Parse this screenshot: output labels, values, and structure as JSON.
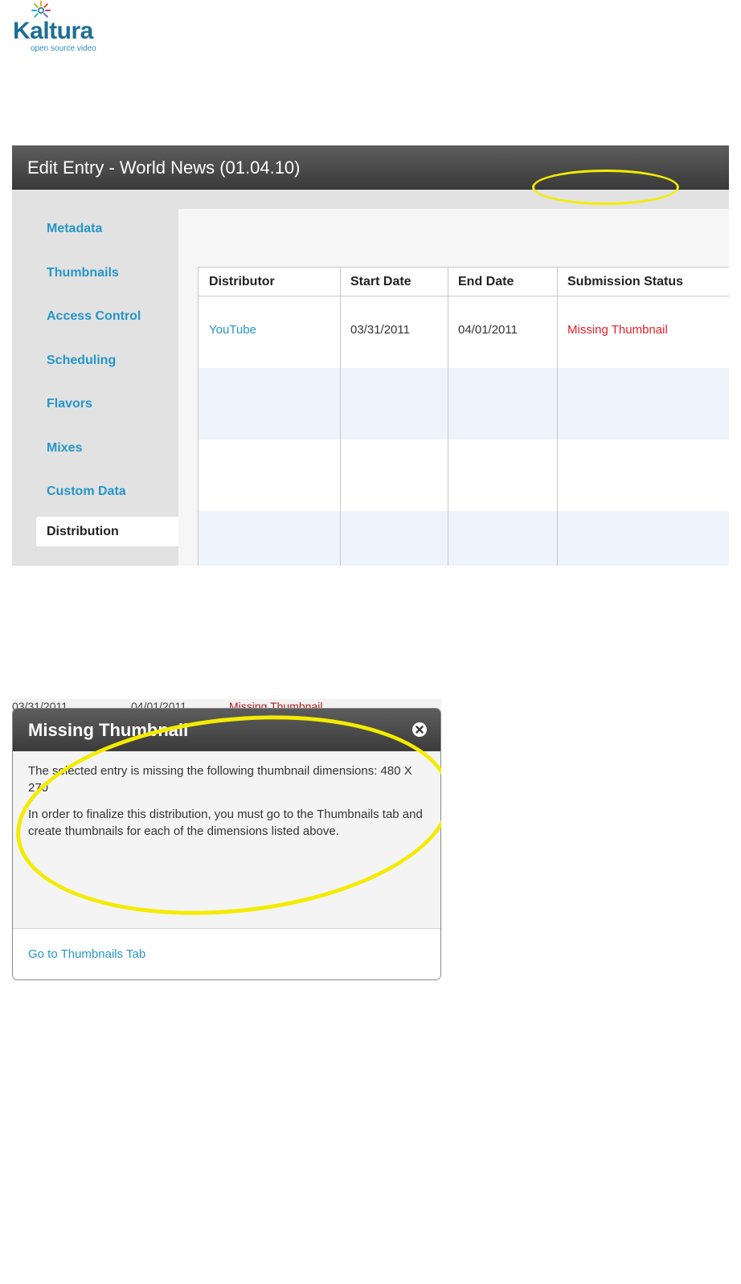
{
  "logo": {
    "wordmark": "Kaltura",
    "tagline": "open source video"
  },
  "edit_entry": {
    "title": "Edit Entry - World News (01.04.10)",
    "nav_items": [
      {
        "label": "Metadata",
        "active": false
      },
      {
        "label": "Thumbnails",
        "active": false
      },
      {
        "label": "Access Control",
        "active": false
      },
      {
        "label": "Scheduling",
        "active": false
      },
      {
        "label": "Flavors",
        "active": false
      },
      {
        "label": "Mixes",
        "active": false
      },
      {
        "label": "Custom Data",
        "active": false
      },
      {
        "label": "Distribution",
        "active": true
      }
    ],
    "table": {
      "columns": [
        "Distributor",
        "Start Date",
        "End Date",
        "Submission Status"
      ],
      "rows": [
        {
          "distributor": "YouTube",
          "start_date": "03/31/2011",
          "end_date": "04/01/2011",
          "status": "Missing Thumbnail"
        }
      ]
    }
  },
  "popup_backdrop": {
    "start_date": "03/31/2011",
    "end_date": "04/01/2011",
    "status": "Missing Thumbnail"
  },
  "popup": {
    "title": "Missing Thumbnail",
    "message_1": "The selected entry is missing the following thumbnail dimensions: 480 X 270",
    "message_2": "In order to finalize this distribution, you must go to the Thumbnails tab and create thumbnails for each of the dimensions listed above.",
    "action_link": "Go to Thumbnails Tab"
  },
  "colors": {
    "link_blue": "#2596c8",
    "error_red": "#e2202a",
    "highlight_yellow": "#f4ec00",
    "header_dark": "#3a3a3a",
    "brand_blue": "#1d6f93"
  },
  "icons": {
    "logo": "sunburst-icon",
    "close": "close-circle-icon"
  }
}
